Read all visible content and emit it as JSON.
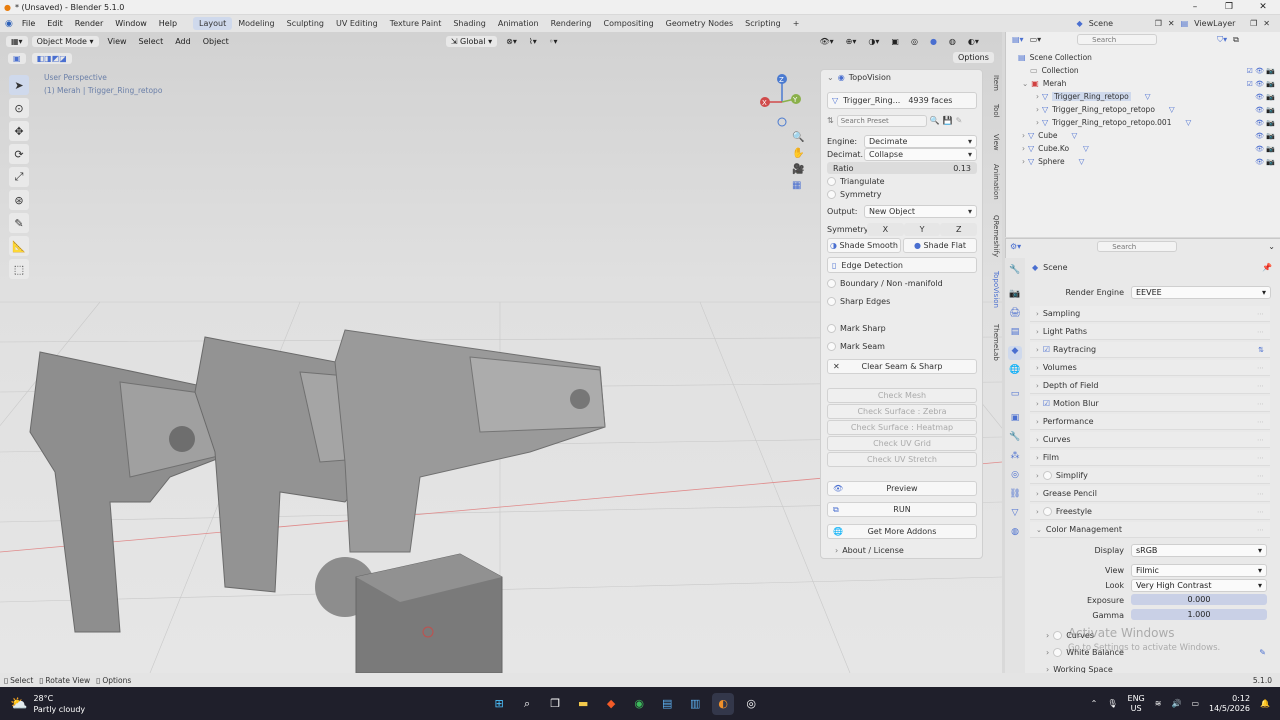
{
  "window": {
    "title": "* (Unsaved) - Blender 5.1.0"
  },
  "menus": [
    "File",
    "Edit",
    "Render",
    "Window",
    "Help"
  ],
  "workspaces": [
    "Layout",
    "Modeling",
    "Sculpting",
    "UV Editing",
    "Texture Paint",
    "Shading",
    "Animation",
    "Rendering",
    "Compositing",
    "Geometry Nodes",
    "Scripting"
  ],
  "active_workspace": "Layout",
  "scene": "Scene",
  "view_layer": "ViewLayer",
  "viewport": {
    "mode": "Object Mode",
    "menu": [
      "View",
      "Select",
      "Add",
      "Object"
    ],
    "transform": "Global",
    "overlay_title": "User Perspective",
    "overlay_object": "(1) Merah | Trigger_Ring_retopo",
    "options": "Options"
  },
  "side_tabs": [
    "Item",
    "Tool",
    "View",
    "Animation",
    "QRemeshify",
    "TopoVision",
    "ThemeLab"
  ],
  "topovision": {
    "title": "TopoVision",
    "object": "Trigger_Ring...",
    "faces": "4939 faces",
    "search_placeholder": "Search Preset",
    "engine_label": "Engine:",
    "engine_value": "Decimate",
    "decimate_label": "Decimat...",
    "decimate_value": "Collapse",
    "ratio_label": "Ratio",
    "ratio_value": "0.13",
    "triangulate": "Triangulate",
    "symmetry": "Symmetry",
    "output_label": "Output:",
    "output_value": "New Object",
    "sym_label": "Symmetry:",
    "sym_axes": [
      "X",
      "Y",
      "Z"
    ],
    "shade_smooth": "Shade Smooth",
    "shade_flat": "Shade Flat",
    "edge_detection": "Edge Detection",
    "boundary": "Boundary / Non -manifold",
    "sharp_edges": "Sharp Edges",
    "mark_sharp": "Mark Sharp",
    "mark_seam": "Mark Seam",
    "clear_seam": "Clear Seam & Sharp",
    "checks": [
      "Check Mesh",
      "Check Surface : Zebra",
      "Check Surface : Heatmap",
      "Check UV Grid",
      "Check UV Stretch"
    ],
    "preview": "Preview",
    "run": "RUN",
    "addons": "Get More Addons",
    "about": "About / License"
  },
  "outliner": {
    "search_placeholder": "Search",
    "items": [
      {
        "label": "Scene Collection",
        "indent": 0,
        "type": "collection"
      },
      {
        "label": "Collection",
        "indent": 1,
        "type": "collection"
      },
      {
        "label": "Merah",
        "indent": 1,
        "type": "collection"
      },
      {
        "label": "Trigger_Ring_retopo",
        "indent": 2,
        "type": "mesh"
      },
      {
        "label": "Trigger_Ring_retopo_retopo",
        "indent": 2,
        "type": "mesh"
      },
      {
        "label": "Trigger_Ring_retopo_retopo.001",
        "indent": 2,
        "type": "mesh"
      },
      {
        "label": "Cube",
        "indent": 1,
        "type": "mesh"
      },
      {
        "label": "Cube.Ko",
        "indent": 1,
        "type": "mesh"
      },
      {
        "label": "Sphere",
        "indent": 1,
        "type": "mesh"
      }
    ]
  },
  "properties": {
    "search_placeholder": "Search",
    "breadcrumb": "Scene",
    "render_engine_label": "Render Engine",
    "render_engine": "EEVEE",
    "sections": [
      "Sampling",
      "Light Paths",
      "Raytracing",
      "Volumes",
      "Depth of Field",
      "Motion Blur",
      "Performance",
      "Curves",
      "Film",
      "Simplify",
      "Grease Pencil",
      "Freestyle",
      "Color Management"
    ],
    "display_label": "Display",
    "display_value": "sRGB",
    "view_label": "View",
    "view_value": "Filmic",
    "look_label": "Look",
    "look_value": "Very High Contrast",
    "exposure_label": "Exposure",
    "exposure_value": "0.000",
    "gamma_label": "Gamma",
    "gamma_value": "1.000",
    "sub_sections": [
      "Curves",
      "White Balance",
      "Working Space"
    ],
    "watermark_1": "Activate Windows",
    "watermark_2": "Go to Settings to activate Windows."
  },
  "status": {
    "select": "Select",
    "rotate": "Rotate View",
    "options": "Options",
    "version": "5.1.0"
  },
  "taskbar": {
    "temp": "28°C",
    "weather": "Partly cloudy",
    "lang1": "ENG",
    "lang2": "US",
    "time": "0:12",
    "date": "14/5/2026"
  },
  "colors": {
    "accent": "#4a6fd0",
    "taskbar": "#1f1f2b"
  }
}
